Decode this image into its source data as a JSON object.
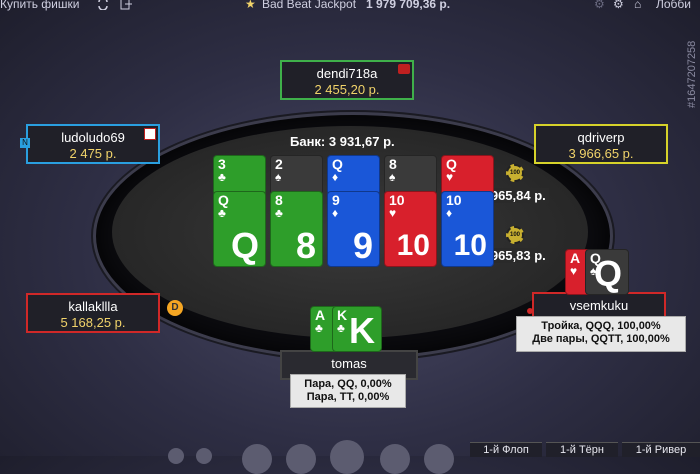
{
  "topbar": {
    "buy_chips": "Купить фишки",
    "jackpot_label": "Bad Beat Jackpot",
    "jackpot_value": "1 979 709,36 р.",
    "lobby": "Лобби"
  },
  "table_id": "#1647207258",
  "pot": "Банк: 3 931,67 р.",
  "seats": {
    "top": {
      "name": "dendi718a",
      "stack": "2 455,20 р."
    },
    "left_top": {
      "name": "ludoludo69",
      "stack": "2 475 р.",
      "tag": "N"
    },
    "right_top": {
      "name": "qdriverp",
      "stack": "3 966,65 р."
    },
    "left_bottom": {
      "name": "kallakllla",
      "stack": "5 168,25 р."
    },
    "right_bottom": {
      "name": "vsemkuku"
    },
    "hero": {
      "name": "tomas"
    }
  },
  "dealer_button": "D",
  "bets": [
    "1 965,84 р.",
    "1 965,83 р."
  ],
  "chip_label": "100",
  "board_row1": [
    {
      "rank": "3",
      "suit": "♣",
      "color": "clubs"
    },
    {
      "rank": "2",
      "suit": "♠",
      "color": "spades"
    },
    {
      "rank": "Q",
      "suit": "♦",
      "color": "diamonds"
    },
    {
      "rank": "8",
      "suit": "♠",
      "color": "spades"
    },
    {
      "rank": "Q",
      "suit": "♥",
      "color": "hearts"
    }
  ],
  "board_row2": [
    {
      "rank": "Q",
      "suit": "♣",
      "color": "clubs",
      "big": "Q"
    },
    {
      "rank": "8",
      "suit": "♣",
      "color": "clubs",
      "big": "8"
    },
    {
      "rank": "9",
      "suit": "♦",
      "color": "diamonds",
      "big": "9"
    },
    {
      "rank": "10",
      "suit": "♥",
      "color": "hearts",
      "big": "10"
    },
    {
      "rank": "10",
      "suit": "♦",
      "color": "diamonds",
      "big": "10"
    }
  ],
  "vsemkuku_cards": [
    {
      "rank": "A",
      "suit": "♥",
      "color": "hearts"
    },
    {
      "rank": "Q",
      "suit": "♠",
      "color": "spades",
      "big": "Q"
    }
  ],
  "hero_cards": [
    {
      "rank": "A",
      "suit": "♣",
      "color": "clubs"
    },
    {
      "rank": "K",
      "suit": "♣",
      "color": "clubs",
      "big": "K"
    }
  ],
  "odds_vsemkuku": [
    "Тройка, QQQ, 100,00%",
    "Две пары, QQTT, 100,00%"
  ],
  "odds_hero": [
    "Пара, QQ, 0,00%",
    "Пара, TT, 0,00%"
  ],
  "tabs": [
    "1-й Флоп",
    "1-й Тёрн",
    "1-й Ривер"
  ]
}
